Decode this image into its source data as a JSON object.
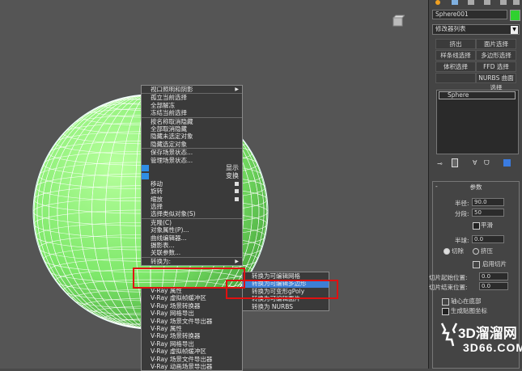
{
  "quad_menu": {
    "items": [
      {
        "label": "视口照明和阴影",
        "arrow": true
      },
      {
        "label": "孤立当前选择"
      },
      {
        "label": "全部解冻"
      },
      {
        "label": "冻结当前选择"
      },
      {
        "label": "按名称取消隐藏"
      },
      {
        "label": "全部取消隐藏"
      },
      {
        "label": "隐藏未选定对象"
      },
      {
        "label": "隐藏选定对象"
      },
      {
        "label": "保存场景状态..."
      },
      {
        "label": "管理场景状态..."
      }
    ],
    "display_label": "显示",
    "transform_label": "变换",
    "transform_items": [
      {
        "label": "移动",
        "box": true
      },
      {
        "label": "旋转",
        "box": true
      },
      {
        "label": "缩放",
        "box": true
      },
      {
        "label": "选择"
      },
      {
        "label": "选择类似对象(S)"
      },
      {
        "label": "克隆(C)"
      },
      {
        "label": "对象属性(P)..."
      },
      {
        "label": "曲线编辑器..."
      },
      {
        "label": "摄影表..."
      },
      {
        "label": "关联参数..."
      },
      {
        "label": "转换为:",
        "arrow": true
      }
    ],
    "vray_items": [
      "V-Ray 属性",
      "V-Ray 虚拟帧缓冲区",
      "V-Ray 场景转换器",
      "V-Ray 网格导出",
      "V-Ray 场景文件导出器",
      "V-Ray 属性",
      "V-Ray 场景转换器",
      "V-Ray 网格导出",
      "V-Ray 虚拟帧缓冲区",
      "V-Ray 场景文件导出器",
      "V-Ray 动画场景导出器"
    ]
  },
  "submenu": {
    "items": [
      "转换为可编辑网格",
      "转换为可编辑多边形",
      "转换为可变形gPoly",
      "转换为可编辑面片",
      "转换为 NURBS"
    ],
    "highlighted_index": 1
  },
  "panel": {
    "object_name": "Sphere001",
    "object_color": "#2fd12f",
    "modifier_list": "修改器列表",
    "buttons": [
      "挤出",
      "面片选择",
      "样条线选择",
      "多边形选择",
      "体积选择",
      "FFD 选择",
      "",
      "NURBS 曲面选择"
    ],
    "stack_item": "Sphere",
    "rollout_title": "参数",
    "radius_label": "半径:",
    "radius_value": "90.0",
    "segments_label": "分段:",
    "segments_value": "50",
    "smooth_label": "平滑",
    "hemisphere_label": "半球:",
    "hemisphere_value": "0.0",
    "chop_label": "切除",
    "squash_label": "挤压",
    "slice_on_label": "启用切片",
    "slice_from_label": "切片起始位置:",
    "slice_from_value": "0.0",
    "slice_to_label": "切片结束位置:",
    "slice_to_value": "0.0",
    "base_pivot_label": "轴心在底部",
    "gen_map_label": "生成贴图坐标"
  },
  "watermark": {
    "big": "3D溜溜网",
    "small": "3D66.COM"
  },
  "colors": {
    "sphere": "#8ff07a",
    "wire": "#ffffff",
    "highlight": "#3d7fd6",
    "red_box": "#e01010"
  }
}
